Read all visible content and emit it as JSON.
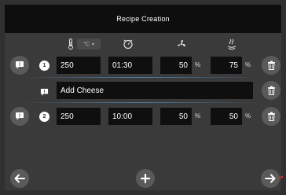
{
  "title": "Recipe Creation",
  "header": {
    "temp_unit": "°C",
    "icons": [
      "thermometer-icon",
      "timer-icon",
      "fan-icon",
      "steam-icon"
    ]
  },
  "steps": [
    {
      "number": "1",
      "temp": "250",
      "time": "01:30",
      "fan": "50",
      "fan_unit": "%",
      "humidity": "75",
      "humidity_unit": "%"
    },
    {
      "number": "2",
      "temp": "250",
      "time": "10:00",
      "fan": "50",
      "fan_unit": "%",
      "humidity": "50",
      "humidity_unit": "%"
    }
  ],
  "note": {
    "text": "Add Cheese"
  },
  "colors": {
    "background": "#3a3a3a",
    "field": "#0f0f0f",
    "accent": "#4d7fa8",
    "arrow_accent": "#c0392b"
  }
}
